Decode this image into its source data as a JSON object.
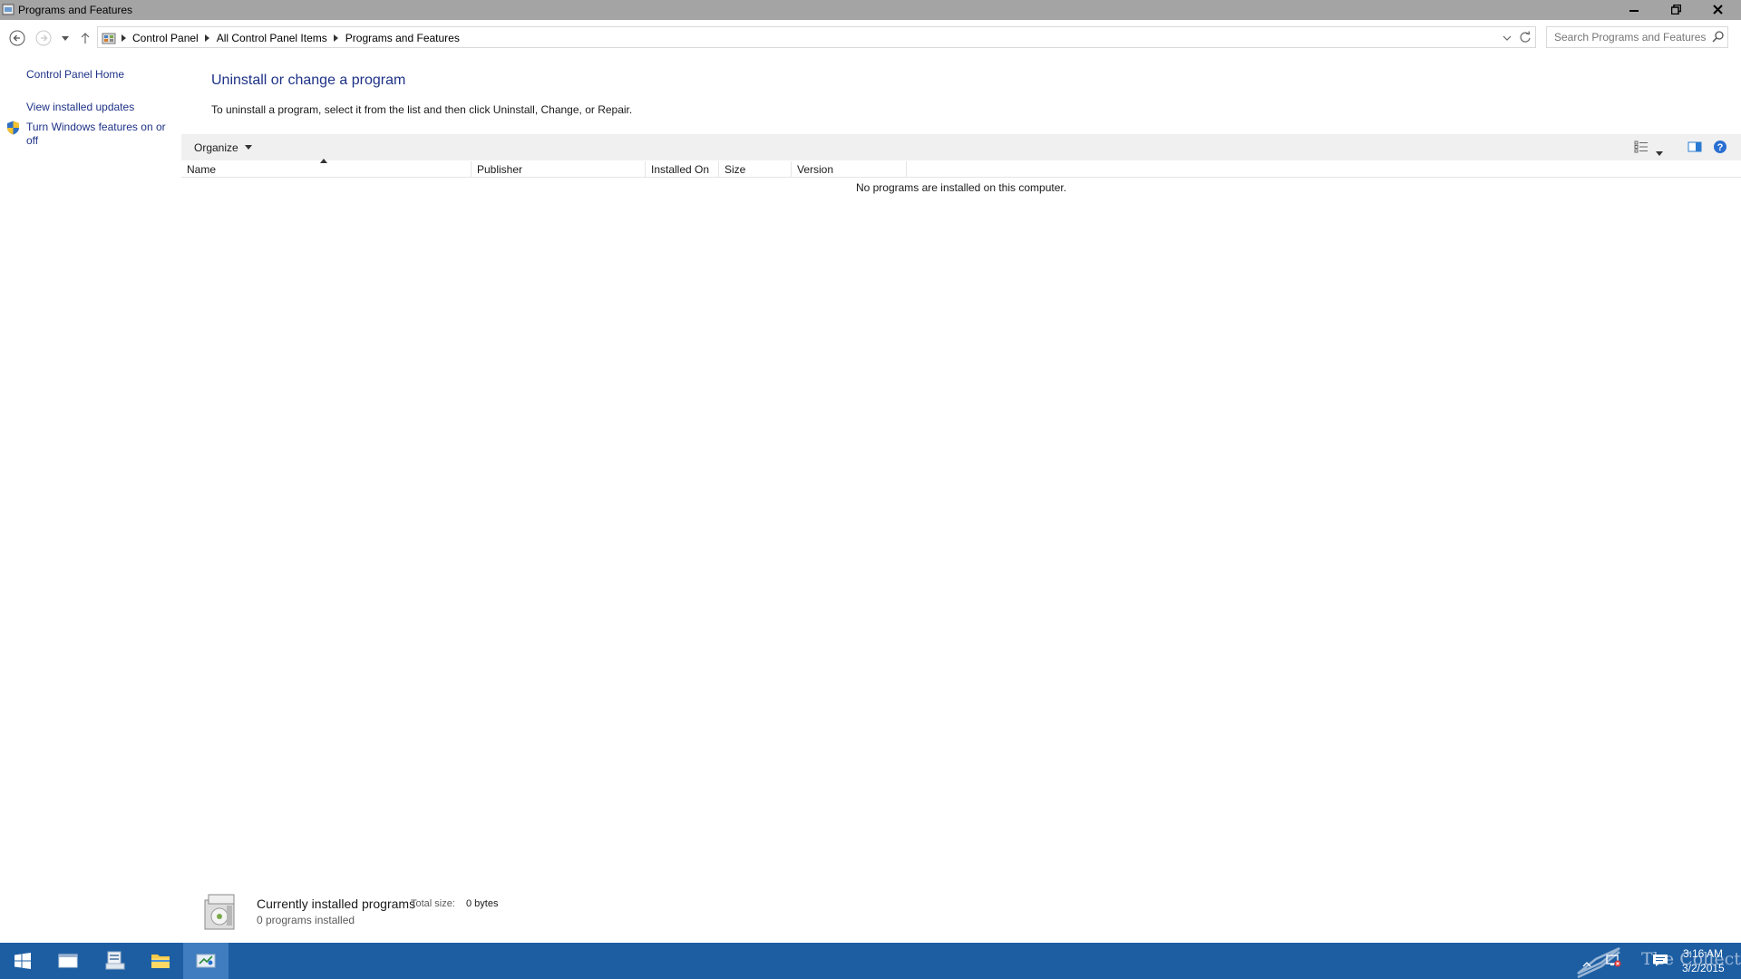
{
  "window": {
    "title": "Programs and Features"
  },
  "address": {
    "breadcrumbs": [
      "Control Panel",
      "All Control Panel Items",
      "Programs and Features"
    ],
    "search_placeholder": "Search Programs and Features"
  },
  "sidebar": {
    "home_link": "Control Panel Home",
    "links": [
      "View installed updates",
      "Turn Windows features on or off"
    ]
  },
  "main": {
    "title": "Uninstall or change a program",
    "instructions": "To uninstall a program, select it from the list and then click Uninstall, Change, or Repair.",
    "organize_label": "Organize",
    "columns": [
      "Name",
      "Publisher",
      "Installed On",
      "Size",
      "Version"
    ],
    "empty_message": "No programs are installed on this computer."
  },
  "details": {
    "title": "Currently installed programs",
    "total_size_label": "Total size:",
    "total_size_value": "0 bytes",
    "count_text": "0 programs installed"
  },
  "taskbar": {
    "time": "3:16 AM",
    "date": "3/2/2015",
    "watermark": "The Collection Book",
    "accent": "#1d5ea3"
  }
}
